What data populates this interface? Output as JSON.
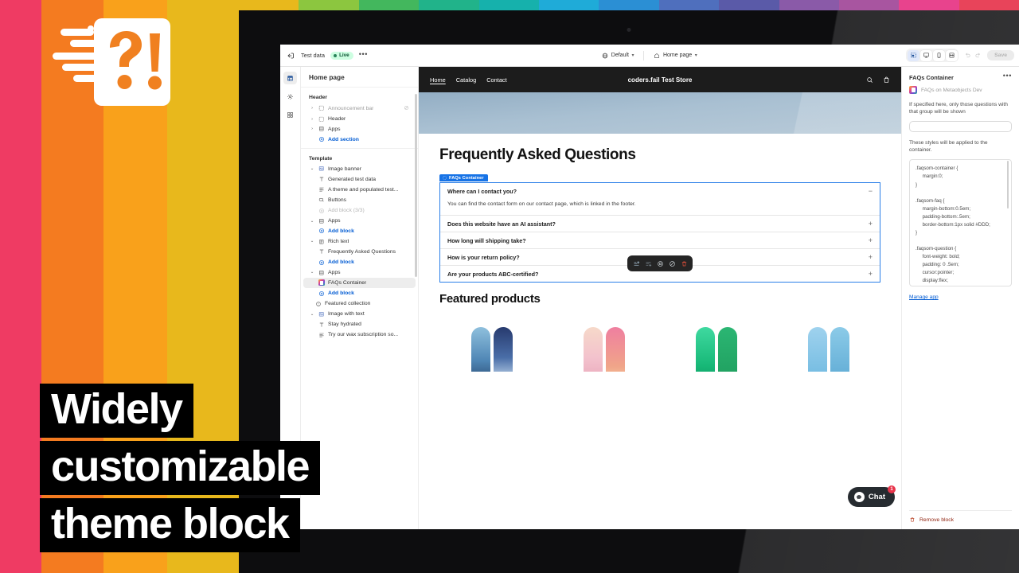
{
  "branding": {
    "logo_name": "speed-faq-logo",
    "stripe_colors": [
      "#ef3b63",
      "#f47b20",
      "#f9a11b",
      "#e8b81c"
    ],
    "rainbow_colors": [
      "#e8b81c",
      "#8cc63f",
      "#43b75d",
      "#21b38a",
      "#16b1ac",
      "#1fabd8",
      "#2b8fd4",
      "#4f6fbd",
      "#5a5aa8",
      "#8a5aa8",
      "#a855a0",
      "#e8438d",
      "#e8445a"
    ]
  },
  "overlay_title": {
    "line1": "Widely",
    "line2": "customizable",
    "line3": "theme block"
  },
  "editor": {
    "topbar": {
      "exit_icon": "exit-icon",
      "theme_name": "Test data",
      "status_badge": "Live",
      "more_icon": "ellipsis-icon",
      "market_selector": "Default",
      "market_icon": "globe-icon",
      "page_selector": "Home page",
      "page_icon": "home-icon",
      "devices": [
        {
          "name": "fullscreen-preview-icon",
          "active": true
        },
        {
          "name": "desktop-icon",
          "active": false
        },
        {
          "name": "mobile-icon",
          "active": false
        },
        {
          "name": "fit-width-icon",
          "active": false
        }
      ],
      "undo_icon": "undo-icon",
      "redo_icon": "redo-icon",
      "save_label": "Save"
    },
    "rail": [
      {
        "name": "sections-icon",
        "active": true
      },
      {
        "name": "theme-settings-icon",
        "active": false
      },
      {
        "name": "apps-icon",
        "active": false
      }
    ],
    "sidebar": {
      "title": "Home page",
      "groups": [
        {
          "label": "Header",
          "items": [
            {
              "label": "Announcement bar",
              "icon": "section-icon",
              "chevron": "collapsed",
              "indent": 0,
              "trailing": "hidden-icon",
              "muted": false,
              "link": false,
              "selected": false
            },
            {
              "label": "Header",
              "icon": "section-icon",
              "chevron": "collapsed",
              "indent": 0,
              "trailing": "",
              "muted": false,
              "link": false,
              "selected": false
            },
            {
              "label": "Apps",
              "icon": "apps-block-icon",
              "chevron": "collapsed",
              "indent": 0,
              "trailing": "",
              "muted": false,
              "link": false,
              "selected": false
            },
            {
              "label": "Add section",
              "icon": "plus-circle-icon",
              "chevron": "",
              "indent": 1,
              "trailing": "",
              "muted": false,
              "link": true,
              "selected": false
            }
          ]
        },
        {
          "label": "Template",
          "items": [
            {
              "label": "Image banner",
              "icon": "image-banner-icon",
              "chevron": "expanded",
              "indent": 0,
              "trailing": "",
              "muted": false,
              "link": false,
              "selected": false
            },
            {
              "label": "Generated test data",
              "icon": "text-block-icon",
              "chevron": "",
              "indent": 1,
              "trailing": "",
              "muted": false,
              "link": false,
              "selected": false
            },
            {
              "label": "A theme and populated test...",
              "icon": "paragraph-icon",
              "chevron": "",
              "indent": 1,
              "trailing": "",
              "muted": false,
              "link": false,
              "selected": false
            },
            {
              "label": "Buttons",
              "icon": "button-icon",
              "chevron": "",
              "indent": 1,
              "trailing": "",
              "muted": false,
              "link": false,
              "selected": false
            },
            {
              "label": "Add block (3/3)",
              "icon": "plus-circle-icon",
              "chevron": "",
              "indent": 1,
              "trailing": "",
              "muted": true,
              "link": false,
              "selected": false
            },
            {
              "label": "Apps",
              "icon": "apps-block-icon",
              "chevron": "expanded",
              "indent": 0,
              "trailing": "",
              "muted": false,
              "link": false,
              "selected": false
            },
            {
              "label": "Add block",
              "icon": "plus-circle-icon",
              "chevron": "",
              "indent": 1,
              "trailing": "",
              "muted": false,
              "link": true,
              "selected": false
            },
            {
              "label": "Rich text",
              "icon": "rich-text-icon",
              "chevron": "expanded",
              "indent": 0,
              "trailing": "",
              "muted": false,
              "link": false,
              "selected": false
            },
            {
              "label": "Frequently Asked Questions",
              "icon": "text-block-icon",
              "chevron": "",
              "indent": 1,
              "trailing": "",
              "muted": false,
              "link": false,
              "selected": false
            },
            {
              "label": "Add block",
              "icon": "plus-circle-icon",
              "chevron": "",
              "indent": 1,
              "trailing": "",
              "muted": false,
              "link": true,
              "selected": false
            },
            {
              "label": "Apps",
              "icon": "apps-block-icon",
              "chevron": "expanded",
              "indent": 0,
              "trailing": "",
              "muted": false,
              "link": false,
              "selected": false
            },
            {
              "label": "FAQs Container",
              "icon": "faqs-app-icon",
              "chevron": "",
              "indent": 1,
              "trailing": "",
              "muted": false,
              "link": false,
              "selected": true
            },
            {
              "label": "Add block",
              "icon": "plus-circle-icon",
              "chevron": "",
              "indent": 1,
              "trailing": "",
              "muted": false,
              "link": true,
              "selected": false
            },
            {
              "label": "Featured collection",
              "icon": "collection-icon",
              "chevron": "",
              "indent": 0,
              "trailing": "",
              "muted": false,
              "link": false,
              "selected": false
            },
            {
              "label": "Image with text",
              "icon": "image-banner-icon",
              "chevron": "expanded",
              "indent": 0,
              "trailing": "",
              "muted": false,
              "link": false,
              "selected": false
            },
            {
              "label": "Stay hydrated",
              "icon": "text-block-icon",
              "chevron": "",
              "indent": 1,
              "trailing": "",
              "muted": false,
              "link": false,
              "selected": false
            },
            {
              "label": "Try our wax subscription so...",
              "icon": "paragraph-icon",
              "chevron": "",
              "indent": 1,
              "trailing": "",
              "muted": false,
              "link": false,
              "selected": false
            }
          ]
        }
      ]
    },
    "preview": {
      "store_nav": {
        "links": [
          "Home",
          "Catalog",
          "Contact"
        ],
        "active_link": "Home",
        "store_title": "coders.fail Test Store",
        "search_icon": "search-icon",
        "cart_icon": "cart-icon"
      },
      "faq_section": {
        "heading": "Frequently Asked Questions",
        "block_tag": "FAQs Container",
        "items": [
          {
            "question": "Where can I contact you?",
            "answer": "You can find the contact form on our contact page, which is linked in the footer.",
            "open": true,
            "sign": "−"
          },
          {
            "question": "Does this website have an AI assistant?",
            "answer": "",
            "open": false,
            "sign": "+"
          },
          {
            "question": "How long will shipping take?",
            "answer": "",
            "open": false,
            "sign": "+"
          },
          {
            "question": "How is your return policy?",
            "answer": "",
            "open": false,
            "sign": "+"
          },
          {
            "question": "Are your products ABC-certified?",
            "answer": "",
            "open": false,
            "sign": "+"
          }
        ]
      },
      "block_toolbar": [
        {
          "name": "move-up-icon"
        },
        {
          "name": "move-down-icon"
        },
        {
          "name": "duplicate-icon"
        },
        {
          "name": "hide-icon"
        },
        {
          "name": "delete-icon"
        }
      ],
      "featured": {
        "heading": "Featured products",
        "products": [
          {
            "colors": [
              "#6fa8c9",
              "#2b3f72"
            ]
          },
          {
            "colors": [
              "#f2c4cf",
              "#ef7fa0"
            ]
          },
          {
            "colors": [
              "#23c882",
              "#1ba35f"
            ]
          },
          {
            "colors": [
              "#7fc4e8",
              "#5aa9d6"
            ]
          }
        ]
      },
      "chat": {
        "label": "Chat",
        "badge": "1",
        "icon": "chat-bubble-icon"
      }
    },
    "inspector": {
      "title": "FAQs Container",
      "more_icon": "ellipsis-icon",
      "app_name": "FAQs on Metaobjects Dev",
      "group_help": "If specified here, only those questions with that group will be shown",
      "group_value": "",
      "styles_help": "These styles will be applied to the container.",
      "css": ".faqsom-container {\n     margin:0;\n}\n\n.faqsom-faq {\n     margin-bottom:0.5em;\n     padding-bottom:.5em;\n     border-bottom:1px solid #DDD;\n}\n\n.faqsom-question {\n     font-weight: bold;\n     padding: 0 .5em;\n     cursor:pointer;\n     display:flex;",
      "manage_link": "Manage app",
      "remove_label": "Remove block",
      "remove_icon": "trash-icon"
    }
  }
}
